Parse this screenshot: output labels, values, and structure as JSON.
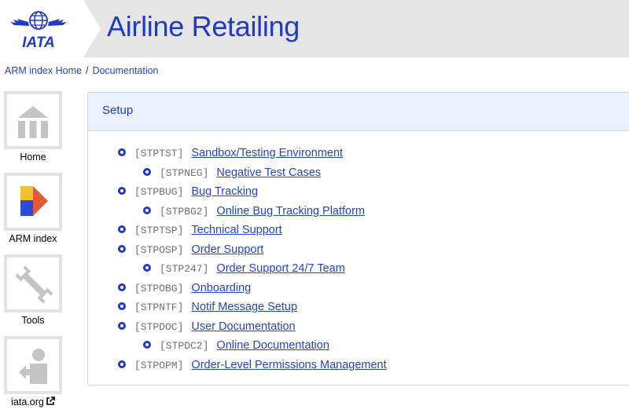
{
  "header": {
    "logo_text": "IATA",
    "title": "Airline Retailing"
  },
  "breadcrumb": {
    "home": "ARM index Home",
    "separator": "/",
    "current": "Documentation"
  },
  "nav": [
    {
      "label": "Home",
      "icon": "home-icon"
    },
    {
      "label": "ARM index",
      "icon": "arm-index-icon"
    },
    {
      "label": "Tools",
      "icon": "wrench-icon"
    },
    {
      "label": "iata.org",
      "icon": "iata-org-icon"
    }
  ],
  "panel": {
    "title": "Setup",
    "items": [
      {
        "code": "[STPTST]",
        "label": "Sandbox/Testing Environment",
        "level": 1
      },
      {
        "code": "[STPNEG]",
        "label": "Negative Test Cases",
        "level": 2
      },
      {
        "code": "[STPBUG]",
        "label": "Bug Tracking",
        "level": 1
      },
      {
        "code": "[STPBG2]",
        "label": "Online Bug Tracking Platform",
        "level": 2
      },
      {
        "code": "[STPTSP]",
        "label": "Technical Support",
        "level": 1
      },
      {
        "code": "[STPOSP]",
        "label": "Order Support",
        "level": 1
      },
      {
        "code": "[STP247]",
        "label": "Order Support 24/7 Team",
        "level": 2
      },
      {
        "code": "[STPOBG]",
        "label": "Onboarding",
        "level": 1
      },
      {
        "code": "[STPNTF]",
        "label": "Notif Message Setup",
        "level": 1
      },
      {
        "code": "[STPDOC]",
        "label": "User Documentation",
        "level": 1
      },
      {
        "code": "[STPDC2]",
        "label": "Online Documentation",
        "level": 2
      },
      {
        "code": "[STPOPM]",
        "label": "Order-Level Permissions Management",
        "level": 1
      }
    ]
  },
  "colors": {
    "accent": "#1f3ac4",
    "link": "#2244cc",
    "header_bg": "#e5e5e5",
    "panel_head_bg": "#eaf0fc"
  }
}
